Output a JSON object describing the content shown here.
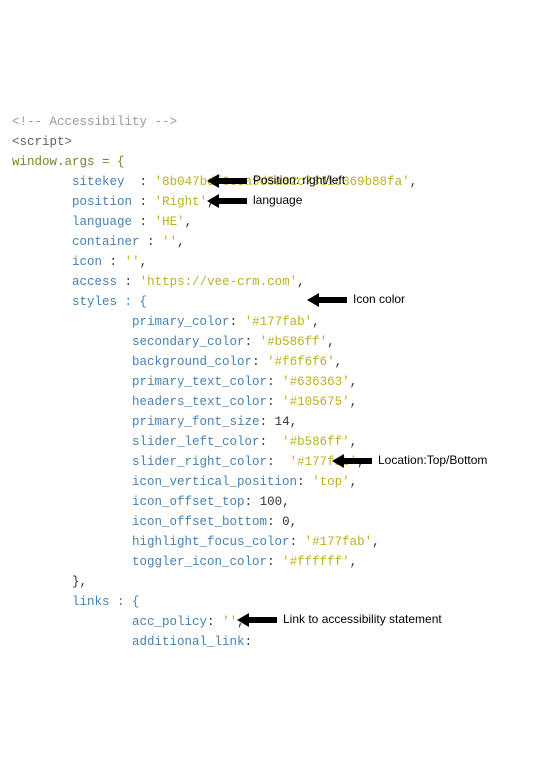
{
  "comment": "<!-- Accessibility -->",
  "script_open": "<script>",
  "win_args": "window.args = {",
  "props": {
    "sitekey": {
      "key": "sitekey",
      "value": "'8b047bdf0cea9d5a82c73d1c369b88fa'",
      "comma": ","
    },
    "position": {
      "key": "position",
      "value": "'Right'",
      "comma": ","
    },
    "language": {
      "key": "language",
      "value": "'HE'",
      "comma": ","
    },
    "container": {
      "key": "container",
      "value": "''",
      "comma": ","
    },
    "icon": {
      "key": "icon",
      "value": "''",
      "comma": ","
    },
    "access": {
      "key": "access",
      "value": "'https://vee-crm.com'",
      "comma": ","
    },
    "styles_label": "styles : {",
    "styles": {
      "primary_color": {
        "key": "primary_color",
        "value": "'#177fab'",
        "comma": ","
      },
      "secondary_color": {
        "key": "secondary_color",
        "value": "'#b586ff'",
        "comma": ","
      },
      "background_color": {
        "key": "background_color",
        "value": "'#f6f6f6'",
        "comma": ","
      },
      "primary_text_color": {
        "key": "primary_text_color",
        "value": "'#636363'",
        "comma": ","
      },
      "headers_text_color": {
        "key": "headers_text_color",
        "value": "'#105675'",
        "comma": ","
      },
      "primary_font_size": {
        "key": "primary_font_size",
        "value": "14",
        "comma": ",",
        "numeric": true
      },
      "slider_left_color": {
        "key": "slider_left_color",
        "value": " '#b586ff'",
        "comma": ","
      },
      "slider_right_color": {
        "key": "slider_right_color",
        "value": " '#177fab'",
        "comma": ","
      },
      "icon_vertical_position": {
        "key": "icon_vertical_position",
        "value": "'top'",
        "comma": ","
      },
      "icon_offset_top": {
        "key": "icon_offset_top",
        "value": "100",
        "comma": ",",
        "numeric": true
      },
      "icon_offset_bottom": {
        "key": "icon_offset_bottom",
        "value": "0",
        "comma": ",",
        "numeric": true
      },
      "highlight_focus_color": {
        "key": "highlight_focus_color",
        "value": "'#177fab'",
        "comma": ","
      },
      "toggler_icon_color": {
        "key": "toggler_icon_color",
        "value": "'#ffffff'",
        "comma": ","
      }
    },
    "styles_close": "},",
    "links_label": "links : {",
    "links": {
      "acc_policy": {
        "key": "acc_policy",
        "value": "''",
        "comma": ","
      },
      "additional_link": {
        "key": "additional_link",
        "value": "",
        "comma": ""
      }
    }
  },
  "annotations": {
    "position": "Position: right/left",
    "language": "language",
    "icon_color": "Icon color",
    "location": "Location:Top/Bottom",
    "link_stmt": "Link to accessibility statement"
  }
}
